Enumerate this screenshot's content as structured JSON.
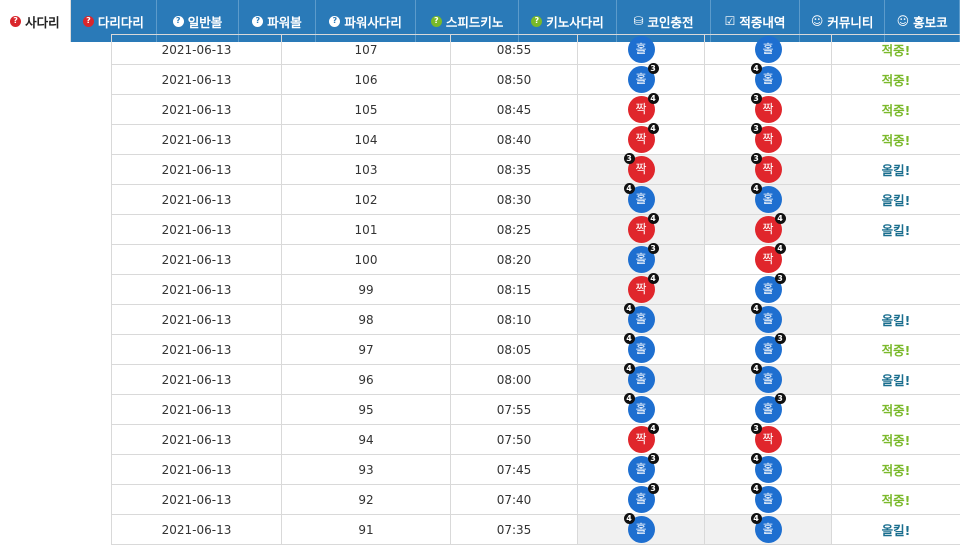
{
  "nav": {
    "tabs": [
      {
        "name": "tab-sadari",
        "label": "사다리",
        "icon": "question-red",
        "active": true,
        "width": 71
      },
      {
        "name": "tab-daridari",
        "label": "다리다리",
        "icon": "question-red",
        "active": false,
        "width": 87
      },
      {
        "name": "tab-ilbanball",
        "label": "일반볼",
        "icon": "question-blue",
        "active": false,
        "width": 82
      },
      {
        "name": "tab-powerball",
        "label": "파워볼",
        "icon": "question-blue",
        "active": false,
        "width": 78
      },
      {
        "name": "tab-powersadari",
        "label": "파워사다리",
        "icon": "question-blue",
        "active": false,
        "width": 100
      },
      {
        "name": "tab-speedkino",
        "label": "스피드키노",
        "icon": "question-green",
        "active": false,
        "width": 104
      },
      {
        "name": "tab-kinosadari",
        "label": "키노사다리",
        "icon": "question-green",
        "active": false,
        "width": 98
      },
      {
        "name": "tab-coin-charge",
        "label": "코인충전",
        "icon": "coins",
        "active": false,
        "width": 95
      },
      {
        "name": "tab-hit-history",
        "label": "적중내역",
        "icon": "checkbox",
        "active": false,
        "width": 89
      },
      {
        "name": "tab-community",
        "label": "커뮤니티",
        "icon": "smile",
        "active": false,
        "width": 86
      },
      {
        "name": "tab-promo",
        "label": "홍보코",
        "icon": "smile",
        "active": false,
        "width": 75
      }
    ]
  },
  "table": {
    "rows": [
      {
        "date": "2021-06-13",
        "round": "107",
        "time": "08:55",
        "a": {
          "label": "홀",
          "color": "odd",
          "num": "",
          "side": "right"
        },
        "b": {
          "label": "홀",
          "color": "odd",
          "num": "",
          "side": "right"
        },
        "result": "적중!",
        "resultColor": "#7ab92a",
        "hl": false
      },
      {
        "date": "2021-06-13",
        "round": "106",
        "time": "08:50",
        "a": {
          "label": "홀",
          "color": "odd",
          "num": "3",
          "side": "right"
        },
        "b": {
          "label": "홀",
          "color": "odd",
          "num": "4",
          "side": "left"
        },
        "result": "적중!",
        "resultColor": "#7ab92a",
        "hl": false
      },
      {
        "date": "2021-06-13",
        "round": "105",
        "time": "08:45",
        "a": {
          "label": "짝",
          "color": "even",
          "num": "4",
          "side": "right"
        },
        "b": {
          "label": "짝",
          "color": "even",
          "num": "3",
          "side": "left"
        },
        "result": "적중!",
        "resultColor": "#7ab92a",
        "hl": false
      },
      {
        "date": "2021-06-13",
        "round": "104",
        "time": "08:40",
        "a": {
          "label": "짝",
          "color": "even",
          "num": "4",
          "side": "right"
        },
        "b": {
          "label": "짝",
          "color": "even",
          "num": "3",
          "side": "left"
        },
        "result": "적중!",
        "resultColor": "#7ab92a",
        "hl": false
      },
      {
        "date": "2021-06-13",
        "round": "103",
        "time": "08:35",
        "a": {
          "label": "짝",
          "color": "even",
          "num": "3",
          "side": "left"
        },
        "b": {
          "label": "짝",
          "color": "even",
          "num": "3",
          "side": "left"
        },
        "result": "올킬!",
        "resultColor": "#1a6e8e",
        "hl": true
      },
      {
        "date": "2021-06-13",
        "round": "102",
        "time": "08:30",
        "a": {
          "label": "홀",
          "color": "odd",
          "num": "4",
          "side": "left"
        },
        "b": {
          "label": "홀",
          "color": "odd",
          "num": "4",
          "side": "left"
        },
        "result": "올킬!",
        "resultColor": "#1a6e8e",
        "hl": true
      },
      {
        "date": "2021-06-13",
        "round": "101",
        "time": "08:25",
        "a": {
          "label": "짝",
          "color": "even",
          "num": "4",
          "side": "right"
        },
        "b": {
          "label": "짝",
          "color": "even",
          "num": "4",
          "side": "right"
        },
        "result": "올킬!",
        "resultColor": "#1a6e8e",
        "hl": true
      },
      {
        "date": "2021-06-13",
        "round": "100",
        "time": "08:20",
        "a": {
          "label": "홀",
          "color": "odd",
          "num": "3",
          "side": "right"
        },
        "b": {
          "label": "짝",
          "color": "even",
          "num": "4",
          "side": "right"
        },
        "result": "",
        "resultColor": "#1a6e8e",
        "hl": "a"
      },
      {
        "date": "2021-06-13",
        "round": "99",
        "time": "08:15",
        "a": {
          "label": "짝",
          "color": "even",
          "num": "4",
          "side": "right"
        },
        "b": {
          "label": "홀",
          "color": "odd",
          "num": "3",
          "side": "right"
        },
        "result": "",
        "resultColor": "#1a6e8e",
        "hl": "a"
      },
      {
        "date": "2021-06-13",
        "round": "98",
        "time": "08:10",
        "a": {
          "label": "홀",
          "color": "odd",
          "num": "4",
          "side": "left"
        },
        "b": {
          "label": "홀",
          "color": "odd",
          "num": "4",
          "side": "left"
        },
        "result": "올킬!",
        "resultColor": "#1a6e8e",
        "hl": true
      },
      {
        "date": "2021-06-13",
        "round": "97",
        "time": "08:05",
        "a": {
          "label": "홀",
          "color": "odd",
          "num": "4",
          "side": "left"
        },
        "b": {
          "label": "홀",
          "color": "odd",
          "num": "3",
          "side": "right"
        },
        "result": "적중!",
        "resultColor": "#7ab92a",
        "hl": false
      },
      {
        "date": "2021-06-13",
        "round": "96",
        "time": "08:00",
        "a": {
          "label": "홀",
          "color": "odd",
          "num": "4",
          "side": "left"
        },
        "b": {
          "label": "홀",
          "color": "odd",
          "num": "4",
          "side": "left"
        },
        "result": "올킬!",
        "resultColor": "#1a6e8e",
        "hl": true
      },
      {
        "date": "2021-06-13",
        "round": "95",
        "time": "07:55",
        "a": {
          "label": "홀",
          "color": "odd",
          "num": "4",
          "side": "left"
        },
        "b": {
          "label": "홀",
          "color": "odd",
          "num": "3",
          "side": "right"
        },
        "result": "적중!",
        "resultColor": "#7ab92a",
        "hl": false
      },
      {
        "date": "2021-06-13",
        "round": "94",
        "time": "07:50",
        "a": {
          "label": "짝",
          "color": "even",
          "num": "4",
          "side": "right"
        },
        "b": {
          "label": "짝",
          "color": "even",
          "num": "3",
          "side": "left"
        },
        "result": "적중!",
        "resultColor": "#7ab92a",
        "hl": false
      },
      {
        "date": "2021-06-13",
        "round": "93",
        "time": "07:45",
        "a": {
          "label": "홀",
          "color": "odd",
          "num": "3",
          "side": "right"
        },
        "b": {
          "label": "홀",
          "color": "odd",
          "num": "4",
          "side": "left"
        },
        "result": "적중!",
        "resultColor": "#7ab92a",
        "hl": false
      },
      {
        "date": "2021-06-13",
        "round": "92",
        "time": "07:40",
        "a": {
          "label": "홀",
          "color": "odd",
          "num": "3",
          "side": "right"
        },
        "b": {
          "label": "홀",
          "color": "odd",
          "num": "4",
          "side": "left"
        },
        "result": "적중!",
        "resultColor": "#7ab92a",
        "hl": false
      },
      {
        "date": "2021-06-13",
        "round": "91",
        "time": "07:35",
        "a": {
          "label": "홀",
          "color": "odd",
          "num": "4",
          "side": "left"
        },
        "b": {
          "label": "홀",
          "color": "odd",
          "num": "4",
          "side": "left"
        },
        "result": "올킬!",
        "resultColor": "#1a6e8e",
        "hl": true
      }
    ]
  },
  "colors": {
    "nav_bg": "#2a7ab8",
    "odd": "#1e6fd0",
    "even": "#e0262c",
    "hit": "#7ab92a",
    "allkill": "#1a6e8e"
  }
}
